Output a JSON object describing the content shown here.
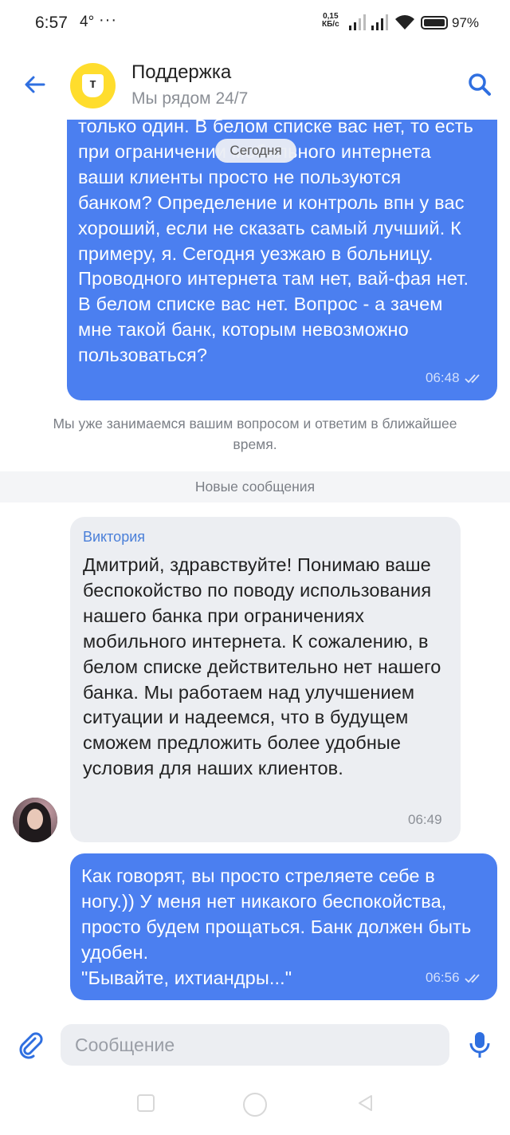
{
  "status_bar": {
    "time": "6:57",
    "temperature": "4°",
    "more": "···",
    "net_speed_value": "0,15",
    "net_speed_unit": "КБ/с",
    "battery": "97%"
  },
  "header": {
    "title": "Поддержка",
    "subtitle": "Мы рядом 24/7",
    "logo_letter": "т"
  },
  "date_pill": "Сегодня",
  "messages": [
    {
      "direction": "outgoing",
      "text": "только один. В белом списке вас нет, то есть при ограничении мобильного интернета ваши клиенты просто не пользуются банком? Определение и контроль впн у вас хороший, если не сказать самый лучший. К примеру, я. Сегодня уезжаю в больницу. Проводного интернета там нет, вай-фая нет. В белом списке вас нет. Вопрос - а зачем мне такой банк, которым невозможно пользоваться?",
      "time": "06:48"
    },
    {
      "direction": "incoming",
      "author": "Виктория",
      "text": "Дмитрий, здравствуйте! Понимаю ваше беспокойство по поводу использования нашего банка при ограничениях мобильного интернета. К сожалению, в белом списке действительно нет нашего банка. Мы работаем над улучше­нием ситуации и надеемся, что в будущем сможем предложить более удобные условия для наших клиентов.",
      "time": "06:49"
    },
    {
      "direction": "outgoing",
      "text": "Как говорят, вы просто стреляете себе в ногу.)) У меня нет никакого беспокой­ства, просто будем прощаться. Банк должен быть удобен.\n\"Бывайте, ихтиандры...\"",
      "time": "06:56"
    }
  ],
  "system_note": "Мы уже занимаемся вашим вопросом и ответим в ближайшее время.",
  "new_messages_label": "Новые сообщения",
  "composer": {
    "placeholder": "Сообщение",
    "value": ""
  },
  "colors": {
    "outgoing_bubble": "#4b7ff0",
    "incoming_bubble": "#eceef2",
    "accent": "#2f6fe0",
    "brand_yellow": "#ffdd2d"
  },
  "icons": [
    "back-arrow-icon",
    "search-icon",
    "attach-icon",
    "mic-icon",
    "double-check-icon",
    "wifi-icon",
    "signal-icon",
    "battery-icon"
  ]
}
